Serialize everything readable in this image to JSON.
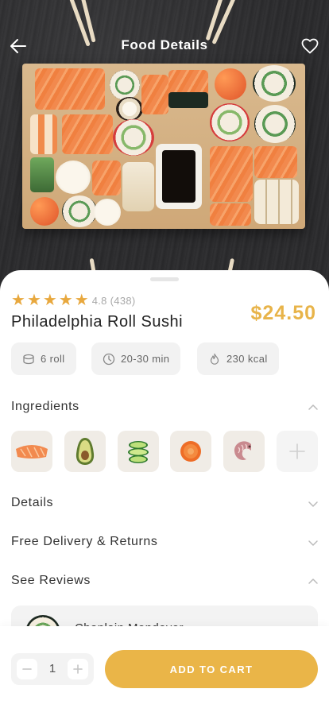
{
  "header": {
    "title": "Food Details",
    "back_icon": "arrow-left-icon",
    "favorite_icon": "heart-icon"
  },
  "product": {
    "rating_stars": 5,
    "rating_value": "4.8",
    "rating_count": "(438)",
    "name": "Philadelphia Roll Sushi",
    "price": "$24.50"
  },
  "chips": [
    {
      "icon": "roll-icon",
      "label": "6 roll"
    },
    {
      "icon": "clock-icon",
      "label": "20-30 min"
    },
    {
      "icon": "flame-icon",
      "label": "230 kcal"
    }
  ],
  "sections": {
    "ingredients": "Ingredients",
    "details": "Details",
    "delivery": "Free Delivery & Returns",
    "reviews": "See Reviews"
  },
  "ingredients": [
    {
      "name": "salmon-icon"
    },
    {
      "name": "avocado-icon"
    },
    {
      "name": "cucumber-icon"
    },
    {
      "name": "carrot-icon"
    },
    {
      "name": "shrimp-icon"
    }
  ],
  "review": {
    "author": "Chaplain Mondover"
  },
  "cart": {
    "quantity": "1",
    "add_label": "ADD TO CART"
  },
  "colors": {
    "accent": "#EAB548",
    "star": "#E8A83E",
    "chip_bg": "#F2F2F2"
  }
}
